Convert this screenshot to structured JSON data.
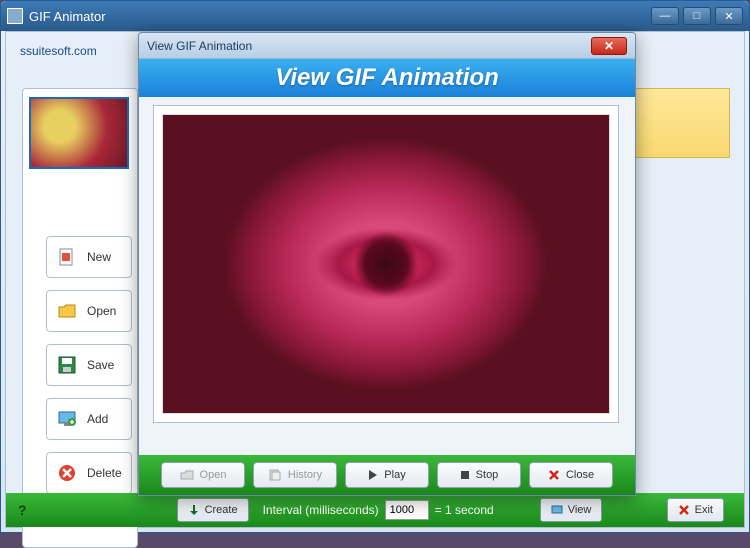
{
  "app": {
    "title": "GIF Animator",
    "link": "ssuitesoft.com"
  },
  "side": {
    "new": "New",
    "open": "Open",
    "save": "Save",
    "add": "Add",
    "delete": "Delete"
  },
  "bottom": {
    "create": "Create",
    "interval_label": "Interval (milliseconds)",
    "interval_value": "1000",
    "interval_hint": "= 1 second",
    "view": "View",
    "exit": "Exit",
    "help": "?"
  },
  "modal": {
    "title": "View GIF Animation",
    "header": "View GIF Animation",
    "open": "Open",
    "history": "History",
    "play": "Play",
    "stop": "Stop",
    "close": "Close"
  }
}
